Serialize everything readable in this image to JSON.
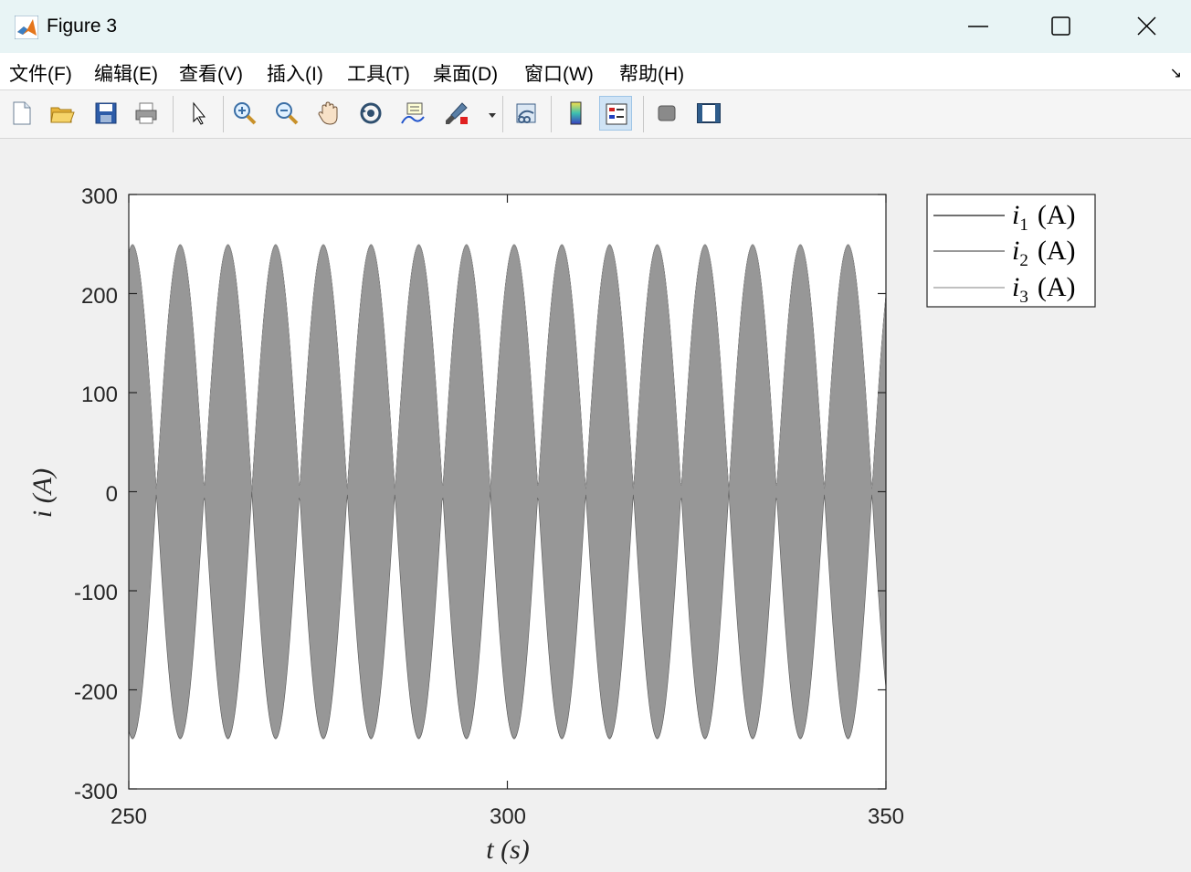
{
  "window": {
    "title": "Figure 3"
  },
  "menu": [
    "文件(F)",
    "编辑(E)",
    "查看(V)",
    "插入(I)",
    "工具(T)",
    "桌面(D)",
    "窗口(W)",
    "帮助(H)"
  ],
  "toolbar": {
    "buttons": [
      "new-figure",
      "open-file",
      "save",
      "print",
      "edit-plot",
      "zoom-in",
      "zoom-out",
      "pan",
      "rotate-3d",
      "data-cursor",
      "brush",
      "link-plot",
      "insert-colorbar",
      "insert-legend",
      "hide-plot-tools",
      "show-plot-tools"
    ]
  },
  "chart_data": {
    "type": "line",
    "x_range": [
      250,
      350
    ],
    "ylim": [
      -300,
      300
    ],
    "xticks": [
      "250",
      "300",
      "350"
    ],
    "yticks": [
      "300",
      "200",
      "100",
      "0",
      "-100",
      "-200",
      "-300"
    ],
    "xlabel": "t (s)",
    "ylabel": "i (A)",
    "legend_placement": "outside-right",
    "series": [
      {
        "name": "i1 (A)",
        "legend_label": "i",
        "subscript": "1",
        "unit": "(A)",
        "color": "#1a1a1a",
        "amplitude": 250,
        "envelope_period": 6.3
      },
      {
        "name": "i2 (A)",
        "legend_label": "i",
        "subscript": "2",
        "unit": "(A)",
        "color": "#5a5a5a",
        "amplitude": 250,
        "envelope_period": 6.3
      },
      {
        "name": "i3 (A)",
        "legend_label": "i",
        "subscript": "3",
        "unit": "(A)",
        "color": "#9a9a9a",
        "amplitude": 250,
        "envelope_period": 6.3
      }
    ],
    "fill_color": "#979797"
  }
}
